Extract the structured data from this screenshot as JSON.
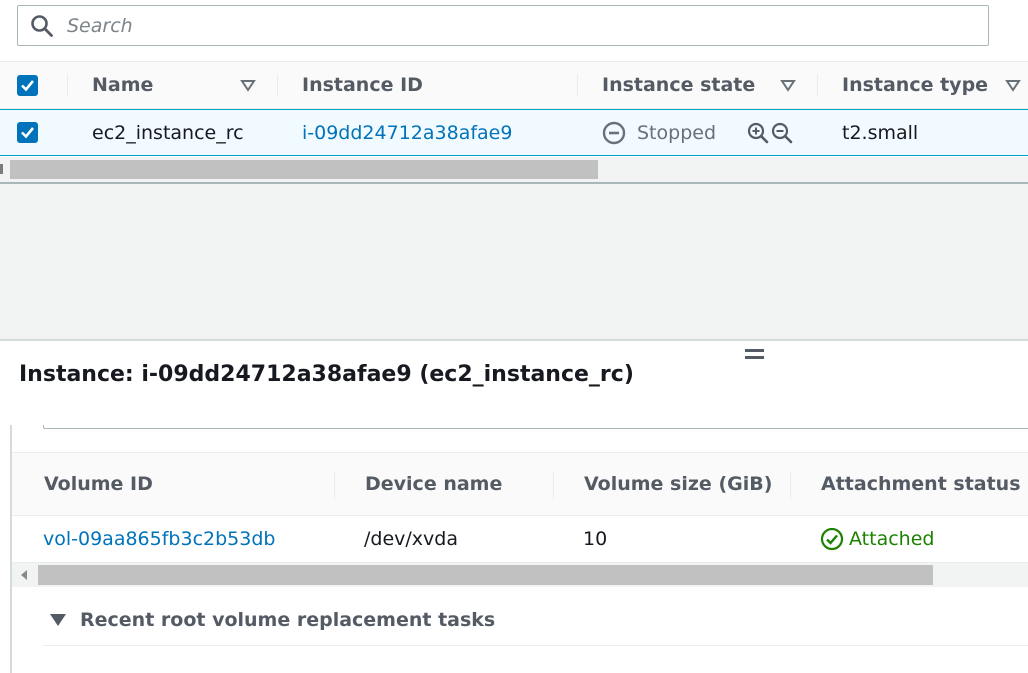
{
  "search": {
    "placeholder": "Search"
  },
  "instances_table": {
    "columns": [
      {
        "label": "Name"
      },
      {
        "label": "Instance ID"
      },
      {
        "label": "Instance state"
      },
      {
        "label": "Instance type"
      }
    ],
    "rows": [
      {
        "name": "ec2_instance_rc",
        "instance_id": "i-09dd24712a38afae9",
        "state": "Stopped",
        "type": "t2.small",
        "selected": true
      }
    ]
  },
  "details": {
    "title": "Instance: i-09dd24712a38afae9 (ec2_instance_rc)",
    "volumes_table": {
      "columns": [
        "Volume ID",
        "Device name",
        "Volume size (GiB)",
        "Attachment status"
      ],
      "rows": [
        {
          "volume_id": "vol-09aa865fb3c2b53db",
          "device": "/dev/xvda",
          "size": "10",
          "status": "Attached"
        }
      ]
    },
    "recent_tasks_label": "Recent root volume replacement tasks"
  },
  "colors": {
    "accent": "#0073bb",
    "link": "#0073bb",
    "success": "#1d8102",
    "selected_row_bg": "#f1faff",
    "selected_row_border": "#00a1c9"
  }
}
